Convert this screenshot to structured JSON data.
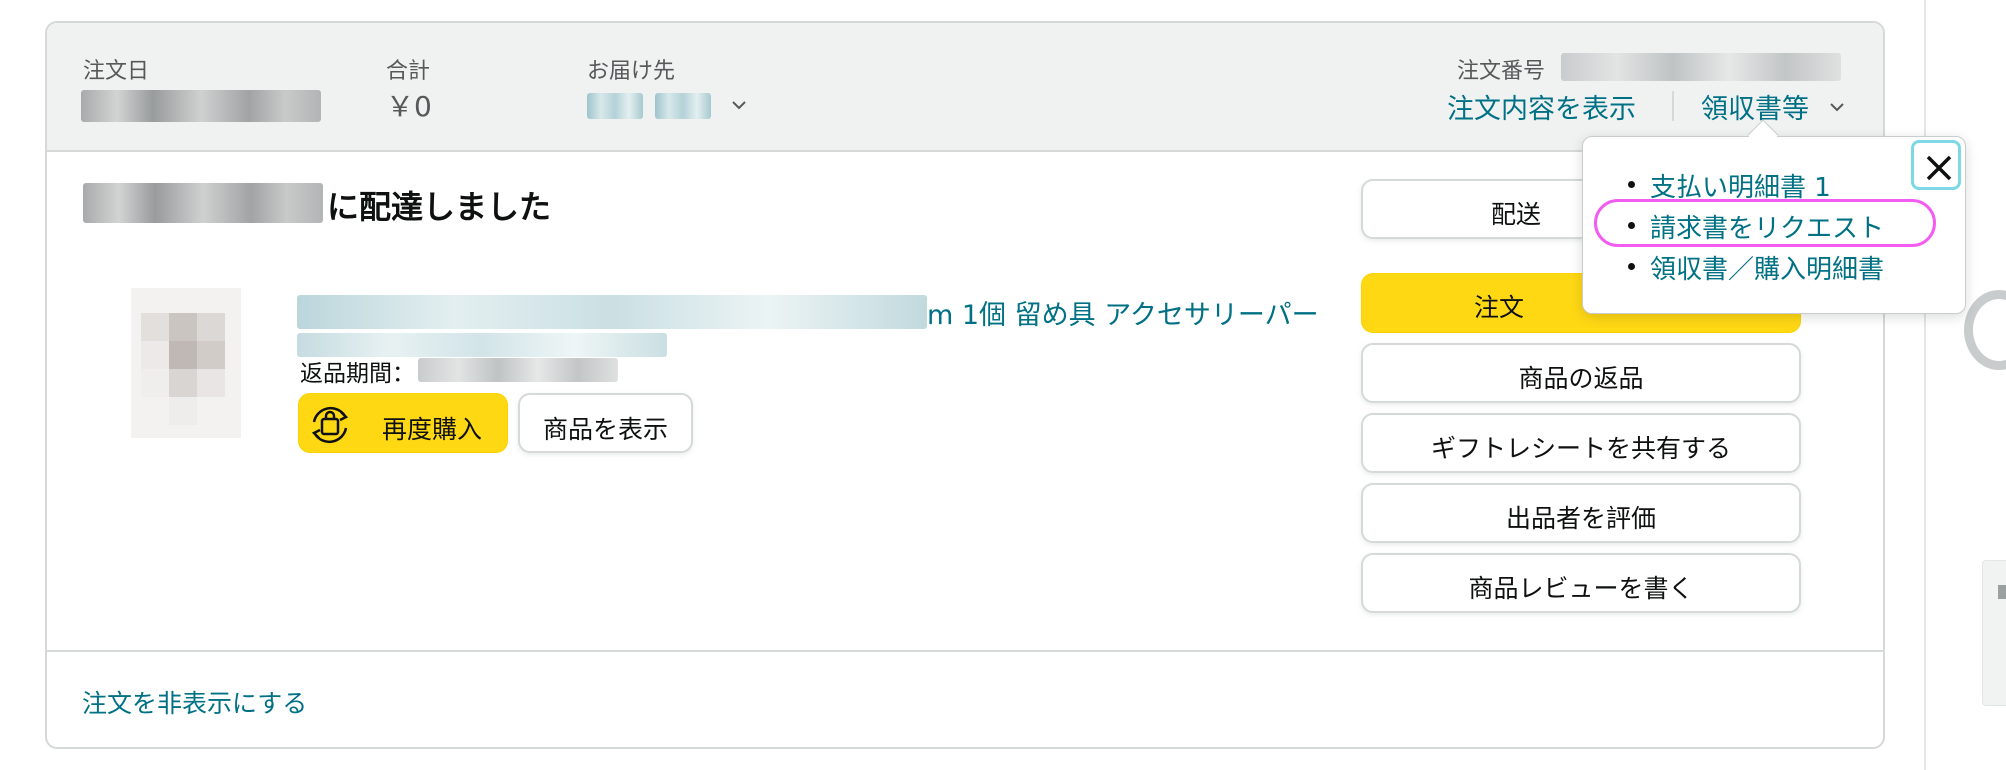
{
  "header": {
    "order_date_label": "注文日",
    "total_label": "合計",
    "total_value": "￥0",
    "ship_to_label": "お届け先",
    "order_number_label": "注文番号",
    "view_order_details": "注文内容を表示",
    "receipts_label": "領収書等"
  },
  "delivery": {
    "status_suffix": "に配達しました"
  },
  "product": {
    "title_visible": "m 1個 留め具 アクセサリーパー",
    "return_window_label": "返品期間："
  },
  "buttons": {
    "buy_again": "再度購入",
    "view_item": "商品を表示",
    "shipment_status_partial": "配送",
    "order_partial": "注文",
    "return_item": "商品の返品",
    "share_gift_receipt": "ギフトレシートを共有する",
    "rate_seller": "出品者を評価",
    "write_review": "商品レビューを書く"
  },
  "footer": {
    "hide_order": "注文を非表示にする"
  },
  "popover": {
    "items": [
      {
        "label": "支払い明細書 1"
      },
      {
        "label": "請求書をリクエスト"
      },
      {
        "label": "領収書／購入明細書"
      }
    ]
  },
  "colors": {
    "link": "#007185",
    "button_yellow": "#ffd814",
    "highlight": "#f25cf0",
    "close_focus": "#7fd8e6"
  },
  "icons": [
    "chevron-down-icon",
    "rebuy-icon",
    "close-icon"
  ]
}
